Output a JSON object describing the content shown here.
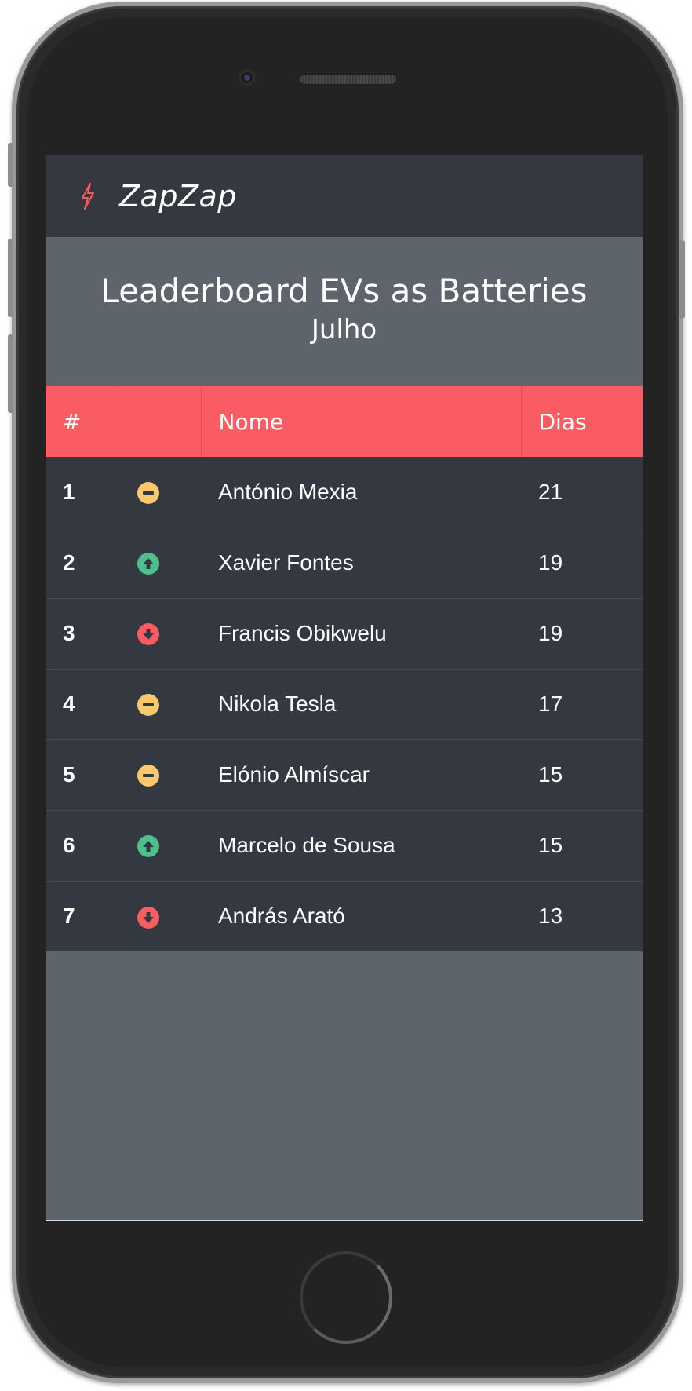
{
  "brand": {
    "name": "ZapZap",
    "icon": "lightning-bolt-icon",
    "icon_color": "#f95c63"
  },
  "hero": {
    "title": "Leaderboard EVs as Batteries",
    "subtitle": "Julho"
  },
  "table": {
    "headers": {
      "rank": "#",
      "trend": "",
      "name": "Nome",
      "days": "Dias"
    },
    "rows": [
      {
        "rank": "1",
        "trend": "same",
        "name": "António Mexia",
        "days": "21"
      },
      {
        "rank": "2",
        "trend": "up",
        "name": "Xavier Fontes",
        "days": "19"
      },
      {
        "rank": "3",
        "trend": "down",
        "name": "Francis Obikwelu",
        "days": "19"
      },
      {
        "rank": "4",
        "trend": "same",
        "name": "Nikola Tesla",
        "days": "17"
      },
      {
        "rank": "5",
        "trend": "same",
        "name": "Elónio Almíscar",
        "days": "15"
      },
      {
        "rank": "6",
        "trend": "up",
        "name": "Marcelo de Sousa",
        "days": "15"
      },
      {
        "rank": "7",
        "trend": "down",
        "name": "András Arató",
        "days": "13"
      }
    ]
  },
  "colors": {
    "header_bg": "#f95c63",
    "row_bg": "#343840",
    "hero_bg": "#5e646c",
    "trend_up": "#4fc08d",
    "trend_down": "#f95c63",
    "trend_same": "#fcc96a"
  }
}
